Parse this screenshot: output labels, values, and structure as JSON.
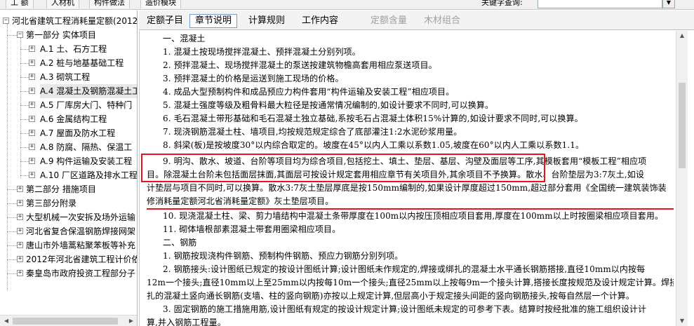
{
  "toolbar": {
    "items": [
      "工 额",
      "人材机",
      "构件做法",
      "造价模块"
    ],
    "search_label": "关键字查询:",
    "search_value": ""
  },
  "tree": {
    "root": "河北省建筑工程消耗量定额(2012",
    "part1": "第一部分 实体项目",
    "chapters": [
      {
        "code": "A.1",
        "name": "土、石方工程"
      },
      {
        "code": "A.2",
        "name": "桩与地基基础工程"
      },
      {
        "code": "A.3",
        "name": "砌筑工程"
      },
      {
        "code": "A.4",
        "name": "混凝土及钢筋混凝土工"
      },
      {
        "code": "A.5",
        "name": "厂库房大门、特种门"
      },
      {
        "code": "A.6",
        "name": "金属结构工程"
      },
      {
        "code": "A.7",
        "name": "屋面及防水工程"
      },
      {
        "code": "A.8",
        "name": "防腐、隔热、保温工"
      },
      {
        "code": "A.9",
        "name": "构件运输及安装工程"
      },
      {
        "code": "A.10",
        "name": "厂区道路及排水工程"
      }
    ],
    "part2": "第二部分 措施项目",
    "part3": "第三部分附录",
    "others": [
      "大型机械一次安拆及场外运输",
      "河北省复合保温钢筋焊接网架",
      "唐山市外墙蒿粘聚苯板等补充",
      "2012年河北省建筑工程计价依",
      "秦皇岛市政府投资工程部分子"
    ]
  },
  "tabs": {
    "items": [
      {
        "label": "定额子目",
        "active": false,
        "disabled": false
      },
      {
        "label": "章节说明",
        "active": true,
        "disabled": false
      },
      {
        "label": "计算规则",
        "active": false,
        "disabled": false
      },
      {
        "label": "工作内容",
        "active": false,
        "disabled": false
      },
      {
        "label": "定额含量",
        "active": false,
        "disabled": true
      },
      {
        "label": "木材组合",
        "active": false,
        "disabled": true
      }
    ]
  },
  "doc": {
    "lines": [
      "一、混凝土",
      "1. 混凝土按现场搅拌混凝土、预拌混凝土分别列项。",
      "2. 预拌混凝土、现场搅拌混凝土的泵送按建筑物檐高套用相应泵送项目。",
      "3. 预拌混凝土的价格是运送到施工现场的价格。",
      "4. 成品大型预制构件和成品预应力构件套用“构件运输及安装工程”相应项目。",
      "5. 混凝土强度等级及粗骨料最大粒径是按通常情况编制的,如设计要求不同时,可以换算。",
      "6. 毛石混凝土带形基础和毛石混凝土独立基础,系按毛石占混凝土体积15%计算的,如设计要求不同时,可以换算。",
      "7. 现浇钢筋混凝土柱、墙项目,均按规范规定综合了底部灌注1:2水泥砂浆用量。",
      "8. 斜梁(板)是按坡度30°以内综合取定的。坡度在45°以内人工乘以系数1.05,坡度在60°以内人工乘以系数1.1。",
      "9. 明沟、散水、坡道、台阶等项目均为综合项目,包括挖土、填土、垫层、基层、沟壁及面层等工序,其模板套用“模板工程”相应项",
      "目。除混凝土台阶未包括面层抹面,其面层可按设计规定套用相应章节有关项目外,其余项目不予换算。散水、台阶垫层为3:7灰土,如设",
      "计垫层与项目不同时,可以换算。散水3:7灰土垫层厚底是按150mm编制的,如果设计厚度超过150mm,超过部分套用《全国统一建筑装饰装",
      "修消耗量定额河北省消耗量定额》灰土垫层项目。",
      "10. 现浇混凝土柱、梁、剪力墙结构中混凝土条带厚度在100m以内按压顶相应项目套用,厚度在100mm以上时按圈梁相应项目套用。",
      "11. 砌体墙根部素混凝土带套用圈梁相应项目。",
      "二、钢筋",
      "1. 钢筋按现浇构件钢筋、预制构件钢筋、预应力钢筋分别列项。",
      "2. 钢筋接头:设计图纸已规定的按设计图纸计算;设计图纸未作规定的,焊接或绑扎的混凝土水平通长钢筋搭接,直径10mm以内按每",
      "12m一个接头;直径10mm以上至25mm以内按每10m一个接头;直径25mm以上按每9m一个接头计算,搭接长度按规范及设计规定计算。焊接或绑",
      "扎的混凝土竖向通长钢筋(支墙、柱的竖向钢筋)亦按以上规定计算,但层高小于规定接头间距的竖向钢筋接头,按每自然层一个计算。",
      "3. 固定钢筋的施工措施用筋,设计图纸有规定的按设计规定计算;设计图纸未规定的可参考下表。结算时按经批准的施工组织设计计",
      "算,并入钢筋工程量。"
    ]
  },
  "colors": {
    "annotation": "#e8141b",
    "active_tab_border": "#7a9bc4"
  }
}
